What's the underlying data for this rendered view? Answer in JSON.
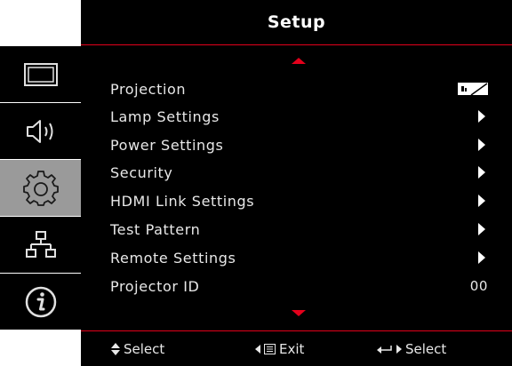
{
  "header": {
    "title": "Setup"
  },
  "sidebar": {
    "tabs": [
      {
        "icon": "display-icon",
        "active": false
      },
      {
        "icon": "audio-icon",
        "active": false
      },
      {
        "icon": "gear-icon",
        "active": true
      },
      {
        "icon": "network-icon",
        "active": false
      },
      {
        "icon": "info-icon",
        "active": false
      }
    ]
  },
  "menu": {
    "items": [
      {
        "label": "Projection",
        "value_icon": "projection-mode-icon"
      },
      {
        "label": "Lamp Settings",
        "value_icon": "chevron-right-icon"
      },
      {
        "label": "Power Settings",
        "value_icon": "chevron-right-icon"
      },
      {
        "label": "Security",
        "value_icon": "chevron-right-icon"
      },
      {
        "label": "HDMI Link Settings",
        "value_icon": "chevron-right-icon"
      },
      {
        "label": "Test Pattern",
        "value_icon": "chevron-right-icon"
      },
      {
        "label": "Remote Settings",
        "value_icon": "chevron-right-icon"
      },
      {
        "label": "Projector ID",
        "value": "00"
      }
    ]
  },
  "footer": {
    "select_label": "Select",
    "exit_label": "Exit",
    "enter_label": "Select"
  },
  "colors": {
    "accent": "#e3001b",
    "background": "#000000",
    "active_tab": "#9a9a9a",
    "text": "#e8e8e8"
  }
}
